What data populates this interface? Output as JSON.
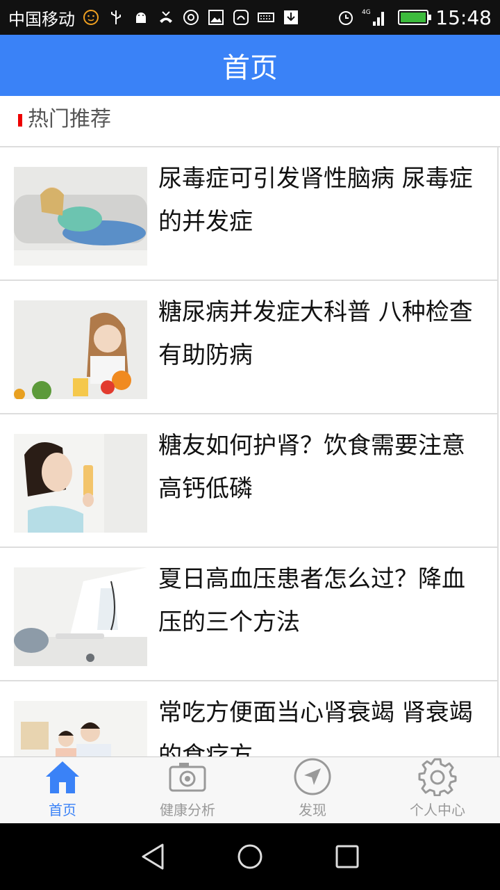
{
  "status": {
    "carrier": "中国移动",
    "network": "4G",
    "time": "15:48"
  },
  "header": {
    "title": "首页"
  },
  "section": {
    "title": "热门推荐"
  },
  "articles": [
    {
      "title": "尿毒症可引发肾性脑病 尿毒症的并发症"
    },
    {
      "title": "糖尿病并发症大科普 八种检查有助防病"
    },
    {
      "title": "糖友如何护肾？饮食需要注意高钙低磷"
    },
    {
      "title": "夏日高血压患者怎么过？降血压的三个方法"
    },
    {
      "title": "常吃方便面当心肾衰竭 肾衰竭的食疗方"
    }
  ],
  "bottomnav": {
    "items": [
      {
        "label": "首页",
        "icon": "home-icon"
      },
      {
        "label": "健康分析",
        "icon": "camera-icon"
      },
      {
        "label": "发现",
        "icon": "compass-icon"
      },
      {
        "label": "个人中心",
        "icon": "gear-icon"
      }
    ]
  },
  "colors": {
    "primary": "#3a82f7",
    "accent_bar": "#ee0000",
    "battery": "#3dbb3d"
  }
}
